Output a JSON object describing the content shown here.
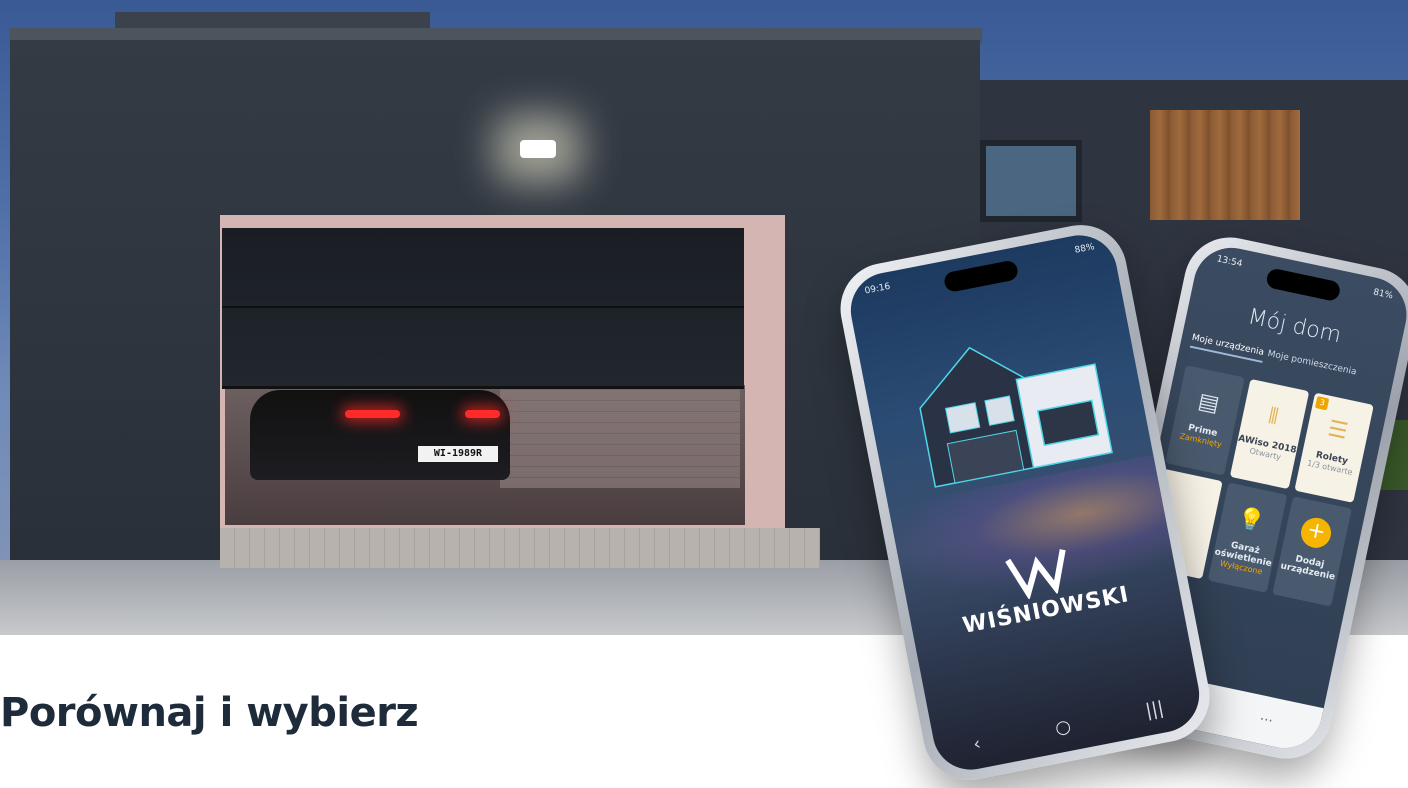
{
  "page": {
    "title": "Porównaj i wybierz"
  },
  "hero": {
    "license_plate": "WI-1989R"
  },
  "phone_left": {
    "status_time": "09:16",
    "status_right": "88%",
    "brand_name": "WIŚNIOWSKI",
    "nav": {
      "back_icon": "‹",
      "home_icon": "○",
      "recents_icon": "|||"
    }
  },
  "phone_right": {
    "status_time": "13:54",
    "status_right": "81%",
    "app_title": "Mój dom",
    "tabs": [
      {
        "label": "Moje urządzenia",
        "active": true
      },
      {
        "label": "Moje pomieszczenia",
        "active": false
      }
    ],
    "tiles": [
      {
        "name": "Prime",
        "status": "Zamknięty",
        "icon": "garage-door-icon",
        "glyph": "▤",
        "style": "dark",
        "badge": ""
      },
      {
        "name": "AWiso 2018",
        "status": "Otwarty",
        "icon": "gate-icon",
        "glyph": "⫴",
        "style": "light",
        "badge": ""
      },
      {
        "name": "Rolety",
        "status": "1/3 otwarte",
        "icon": "blinds-icon",
        "glyph": "☰",
        "style": "light",
        "badge": "3"
      },
      {
        "name": "",
        "status": "",
        "icon": "",
        "glyph": "",
        "style": "light",
        "badge": ""
      },
      {
        "name": "Garaż oświetlenie",
        "status": "Wyłączone",
        "icon": "bulb-icon",
        "glyph": "💡",
        "style": "dark",
        "badge": ""
      },
      {
        "name": "Dodaj urządzenie",
        "status": "",
        "icon": "add-icon",
        "glyph": "+",
        "style": "dark",
        "badge": ""
      }
    ],
    "bottom_menu": "···",
    "bottom_nav": "|||"
  },
  "colors": {
    "title": "#1e2b3b",
    "accent_yellow": "#f6b500",
    "app_bg": "#3b4c62"
  }
}
